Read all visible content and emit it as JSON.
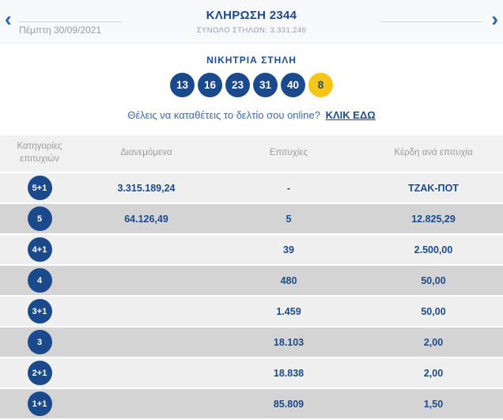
{
  "colors": {
    "brand_blue": "#1b4a8c",
    "joker_yellow": "#f6c51a",
    "link_blue": "#1b4a8c",
    "cta_text_blue": "#3a6bab",
    "muted_gray": "#9b9b9b",
    "subtitle_gray_blue": "#8d9cb5",
    "row_light": "#efefef",
    "row_dark": "#d4d4d4",
    "header_bg": "#f1f1f1",
    "nav_bg": "#f8f9fb"
  },
  "icons": {
    "chevron_left": "‹",
    "chevron_right": "›"
  },
  "nav": {
    "title": "ΚΛΗΡΩΣΗ 2344",
    "subtitle": "ΣΥΝΟΛΟ ΣΤΗΛΩΝ: 3.331.246",
    "date": "Πέμπτη 30/09/2021"
  },
  "winning": {
    "section_title": "ΝΙΚΗΤΡΙΑ ΣΤΗΛΗ",
    "numbers": [
      "13",
      "16",
      "23",
      "31",
      "40"
    ],
    "joker": "8"
  },
  "cta": {
    "text": "Θέλεις να καταθέτεις το δελτίο σου online?",
    "link_label": "ΚΛΙΚ ΕΔΩ"
  },
  "table": {
    "headers": {
      "category": "Κατηγορίες επιτυχιών",
      "distributed": "Διανεμόμενα",
      "winners": "Επιτυχίες",
      "prize": "Κέρδη ανά επιτυχία"
    },
    "rows": [
      {
        "category": "5+1",
        "distributed": "3.315.189,24",
        "winners": "-",
        "prize": "ΤΖΑΚ-ΠΟΤ"
      },
      {
        "category": "5",
        "distributed": "64.126,49",
        "winners": "5",
        "prize": "12.825,29"
      },
      {
        "category": "4+1",
        "distributed": "",
        "winners": "39",
        "prize": "2.500,00"
      },
      {
        "category": "4",
        "distributed": "",
        "winners": "480",
        "prize": "50,00"
      },
      {
        "category": "3+1",
        "distributed": "",
        "winners": "1.459",
        "prize": "50,00"
      },
      {
        "category": "3",
        "distributed": "",
        "winners": "18.103",
        "prize": "2,00"
      },
      {
        "category": "2+1",
        "distributed": "",
        "winners": "18.838",
        "prize": "2,00"
      },
      {
        "category": "1+1",
        "distributed": "",
        "winners": "85.809",
        "prize": "1,50"
      }
    ]
  }
}
